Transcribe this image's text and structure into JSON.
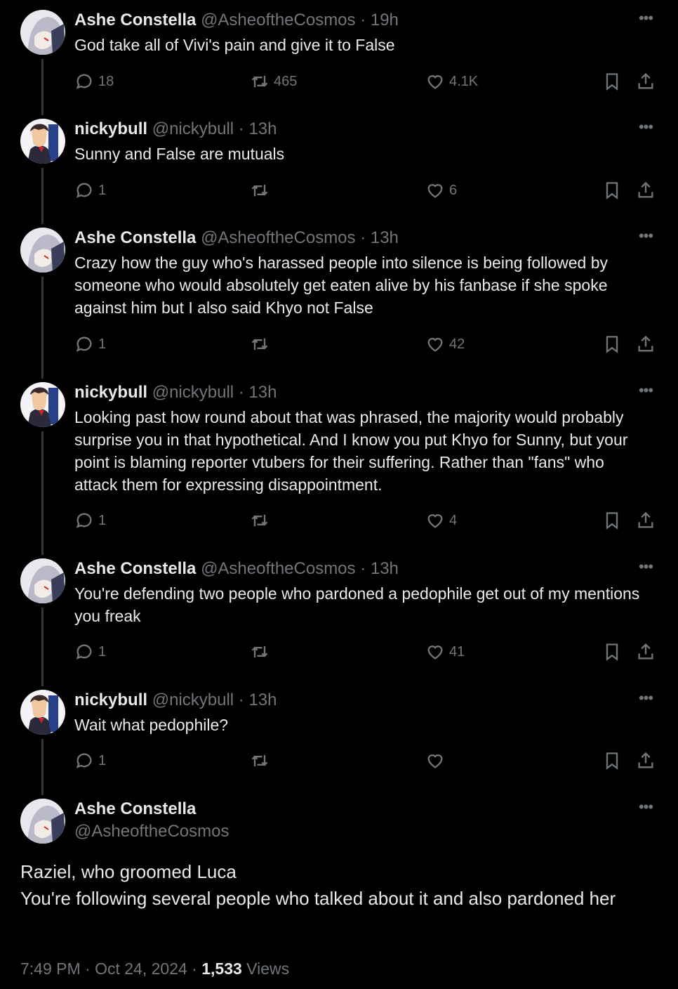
{
  "replies": [
    {
      "name": "Ashe Constella",
      "handle": "@AsheoftheCosmos",
      "time": "· 19h",
      "text": "God take all of Vivi's pain and give it to False",
      "reply_count": "18",
      "retweet_count": "465",
      "like_count": "4.1K",
      "avatar": "ashe"
    },
    {
      "name": "nickybull",
      "handle": "@nickybull",
      "time": "· 13h",
      "text": "Sunny and False are mutuals",
      "reply_count": "1",
      "retweet_count": "",
      "like_count": "6",
      "avatar": "nicky"
    },
    {
      "name": "Ashe Constella",
      "handle": "@AsheoftheCosmos",
      "time": "· 13h",
      "text": "Crazy how the guy who's harassed people into silence is being followed by someone who would absolutely get eaten alive by his fanbase if she spoke against him but I also said Khyo not False",
      "reply_count": "1",
      "retweet_count": "",
      "like_count": "42",
      "avatar": "ashe"
    },
    {
      "name": "nickybull",
      "handle": "@nickybull",
      "time": "· 13h",
      "text": "Looking past how round about that was phrased, the majority would probably surprise you in that hypothetical. And I know you put Khyo for Sunny, but your point is blaming reporter vtubers for their suffering. Rather than \"fans\" who attack them for expressing disappointment.",
      "reply_count": "1",
      "retweet_count": "",
      "like_count": "4",
      "avatar": "nicky"
    },
    {
      "name": "Ashe Constella",
      "handle": "@AsheoftheCosmos",
      "time": "· 13h",
      "text": "You're defending two people who pardoned a pedophile get out of my mentions you freak",
      "reply_count": "1",
      "retweet_count": "",
      "like_count": "41",
      "avatar": "ashe"
    },
    {
      "name": "nickybull",
      "handle": "@nickybull",
      "time": "· 13h",
      "text": "Wait what pedophile?",
      "reply_count": "1",
      "retweet_count": "",
      "like_count": "",
      "avatar": "nicky"
    }
  ],
  "main": {
    "name": "Ashe Constella",
    "handle": "@AsheoftheCosmos",
    "text_line1": "Raziel, who groomed Luca",
    "text_line2": "You're following several people who talked about it and also pardoned her",
    "time": "7:49 PM · Oct 24, 2024 · ",
    "views_count": "1,533",
    "views_label": " Views"
  },
  "icons": {
    "more": "more-icon",
    "reply": "reply-icon",
    "retweet": "retweet-icon",
    "like": "heart-icon",
    "bookmark": "bookmark-icon",
    "share": "share-icon"
  },
  "colors": {
    "background": "#000000",
    "text": "#e7e9ea",
    "muted": "#71767b",
    "thread_line": "#333639"
  }
}
